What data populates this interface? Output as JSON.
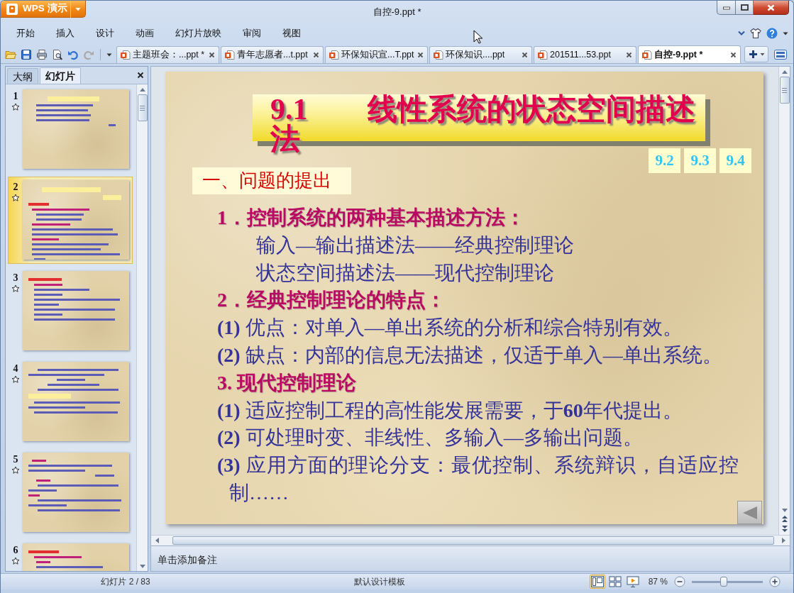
{
  "app_menu": {
    "label": "WPS 演示"
  },
  "window": {
    "title": "自控-9.ppt *"
  },
  "menu": [
    "开始",
    "插入",
    "设计",
    "动画",
    "幻灯片放映",
    "审阅",
    "视图"
  ],
  "quick_access": {
    "undo": {
      "disabled": false
    },
    "redo": {
      "disabled": true
    }
  },
  "document_tabs": [
    {
      "label": "主题班会：...ppt *",
      "selected": false
    },
    {
      "label": "青年志愿者...t.ppt",
      "selected": false
    },
    {
      "label": "环保知识宣...T.ppt",
      "selected": false
    },
    {
      "label": "环保知识....ppt",
      "selected": false
    },
    {
      "label": "201511...53.ppt",
      "selected": false
    },
    {
      "label": "自控-9.ppt *",
      "selected": true
    }
  ],
  "side_panel": {
    "tabs": [
      {
        "label": "大纲",
        "selected": false
      },
      {
        "label": "幻灯片",
        "selected": true
      }
    ],
    "thumbnails": [
      {
        "number": "1",
        "selected": false
      },
      {
        "number": "2",
        "selected": true
      },
      {
        "number": "3",
        "selected": false
      },
      {
        "number": "4",
        "selected": false
      },
      {
        "number": "5",
        "selected": false
      },
      {
        "number": "6",
        "selected": false
      }
    ]
  },
  "slide": {
    "title": "9.1　　线性系统的状态空间描述法",
    "nav_links": [
      "9.2",
      "9.3",
      "9.4"
    ],
    "section_heading": "一、问题的提出",
    "lines": [
      {
        "kind": "heading",
        "text": "1．控制系统的两种基本描述方法："
      },
      {
        "kind": "sub",
        "text": "输入—输出描述法——经典控制理论"
      },
      {
        "kind": "sub",
        "text": "状态空间描述法——现代控制理论"
      },
      {
        "kind": "heading",
        "text": "2．经典控制理论的特点："
      },
      {
        "kind": "item",
        "text": "**(1)** 优点：对单入—单出系统的分析和综合特别有效。"
      },
      {
        "kind": "item",
        "text": "**(2)** 缺点：内部的信息无法描述，仅适于单入—单出系统。"
      },
      {
        "kind": "heading",
        "text": "3.  现代控制理论"
      },
      {
        "kind": "item",
        "text": "**(1)** 适应控制工程的高性能发展需要，于**60**年代提出。"
      },
      {
        "kind": "item",
        "text": "**(2)** 可处理时变、非线性、多输入—多输出问题。"
      },
      {
        "kind": "item",
        "text": "**(3)** 应用方面的理论分支：最优控制、系统辩识，自适应控制……"
      }
    ]
  },
  "notes": {
    "placeholder": "单击添加备注"
  },
  "status_bar": {
    "slide_counter": "幻灯片 2 / 83",
    "template": "默认设计模板",
    "views": [
      {
        "selected": true
      },
      {
        "selected": false
      },
      {
        "selected": false
      }
    ],
    "zoom": {
      "text": "87 %",
      "level": 0.45
    }
  }
}
